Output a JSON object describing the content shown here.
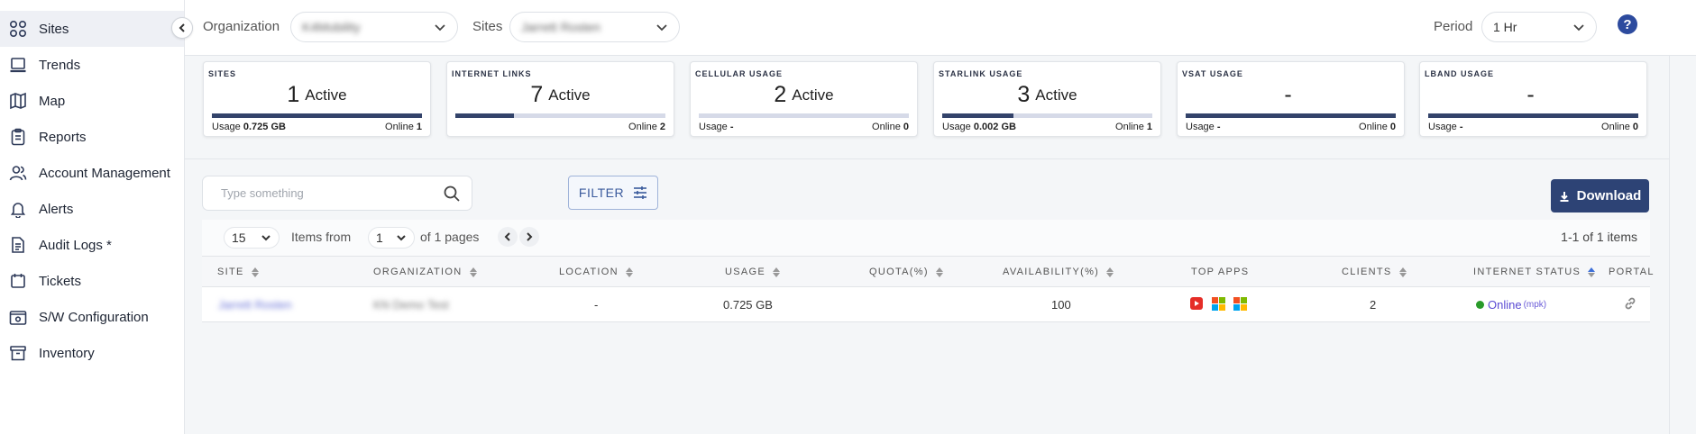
{
  "sidebar": {
    "items": [
      {
        "label": "Sites",
        "icon": "grid-icon"
      },
      {
        "label": "Trends",
        "icon": "laptop-icon"
      },
      {
        "label": "Map",
        "icon": "map-icon"
      },
      {
        "label": "Reports",
        "icon": "clipboard-icon"
      },
      {
        "label": "Account Management",
        "icon": "users-icon"
      },
      {
        "label": "Alerts",
        "icon": "bell-icon"
      },
      {
        "label": "Audit Logs *",
        "icon": "document-icon"
      },
      {
        "label": "Tickets",
        "icon": "ticket-icon"
      },
      {
        "label": "S/W Configuration",
        "icon": "settings-box-icon"
      },
      {
        "label": "Inventory",
        "icon": "archive-icon"
      }
    ]
  },
  "topbar": {
    "organization_label": "Organization",
    "organization_value": "K4Mobility",
    "sites_label": "Sites",
    "sites_value": "Jarrett Rosten",
    "period_label": "Period",
    "period_value": "1 Hr"
  },
  "cards": [
    {
      "title": "SITES",
      "count": "1",
      "state": "Active",
      "usage_label": "Usage",
      "usage": "0.725 GB",
      "online_label": "Online",
      "online": "1",
      "fill": 1.0
    },
    {
      "title": "INTERNET LINKS",
      "count": "7",
      "state": "Active",
      "usage_label": "",
      "usage": "",
      "online_label": "Online",
      "online": "2",
      "fill": 0.28
    },
    {
      "title": "CELLULAR USAGE",
      "count": "2",
      "state": "Active",
      "usage_label": "Usage",
      "usage": "-",
      "online_label": "Online",
      "online": "0",
      "fill": 0.0
    },
    {
      "title": "STARLINK USAGE",
      "count": "3",
      "state": "Active",
      "usage_label": "Usage",
      "usage": "0.002 GB",
      "online_label": "Online",
      "online": "1",
      "fill": 0.34
    },
    {
      "title": "VSAT USAGE",
      "count": "-",
      "state": "",
      "usage_label": "Usage",
      "usage": "-",
      "online_label": "Online",
      "online": "0",
      "fill": 1.0
    },
    {
      "title": "LBAND USAGE",
      "count": "-",
      "state": "",
      "usage_label": "Usage",
      "usage": "-",
      "online_label": "Online",
      "online": "0",
      "fill": 1.0
    }
  ],
  "search": {
    "placeholder": "Type something"
  },
  "filter_label": "FILTER",
  "download_label": "Download",
  "pager": {
    "page_size": "15",
    "items_from": "Items from",
    "page": "1",
    "of_pages": "of 1 pages",
    "count": "1-1 of 1 items"
  },
  "table": {
    "columns": [
      "SITE",
      "ORGANIZATION",
      "LOCATION",
      "USAGE",
      "QUOTA(%)",
      "AVAILABILITY(%)",
      "TOP APPS",
      "CLIENTS",
      "INTERNET STATUS",
      "PORTAL"
    ],
    "rows": [
      {
        "site": "Jarrett Rosten",
        "organization": "KN Demo Test",
        "location": "-",
        "usage": "0.725 GB",
        "quota": "",
        "availability": "100",
        "top_apps": [
          "youtube-icon",
          "microsoft-icon",
          "microsoft-icon"
        ],
        "clients": "2",
        "status": "Online",
        "status_sub": "(mpk)"
      }
    ]
  },
  "colors": {
    "primary": "#2d4375",
    "online": "#2a9b2a",
    "link": "#6a74d8"
  }
}
